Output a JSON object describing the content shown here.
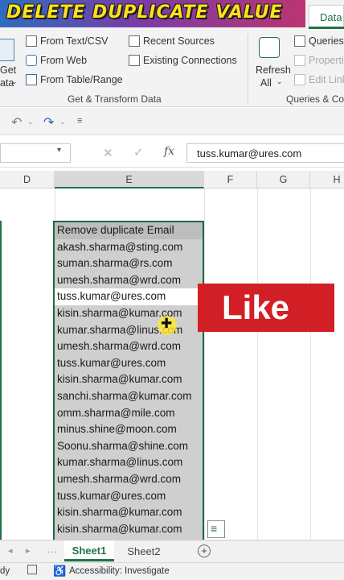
{
  "banner": {
    "title": "DELETE DUPLICATE VALUE"
  },
  "ribbon": {
    "active_tab": "Data",
    "get_data_label_1": "Get",
    "get_data_label_2": "ata",
    "get_transform": {
      "from_text": "From Text/CSV",
      "from_web": "From Web",
      "from_table": "From Table/Range",
      "recent_sources": "Recent Sources",
      "existing_connections": "Existing Connections",
      "group_label": "Get & Transform Data"
    },
    "queries": {
      "refresh_1": "Refresh",
      "refresh_2": "All",
      "queries_label": "Queries",
      "properties_label": "Properti",
      "edit_links_label": "Edit Link",
      "group_label": "Queries & Co"
    }
  },
  "formula_bar": {
    "value": "tuss.kumar@ures.com",
    "fx": "fx"
  },
  "columns": [
    "D",
    "E",
    "F",
    "G",
    "H"
  ],
  "table": {
    "header": "Remove duplicate Email",
    "rows": [
      "akash.sharma@sting.com",
      "suman.sharma@rs.com",
      "umesh.sharma@wrd.com",
      "tuss.kumar@ures.com",
      "kisin.sharma@kumar.com",
      "kumar.sharma@linus.com",
      "umesh.sharma@wrd.com",
      "tuss.kumar@ures.com",
      "kisin.sharma@kumar.com",
      "sanchi.sharma@kumar.com",
      "omm.sharma@mile.com",
      "minus.shine@moon.com",
      "Soonu.sharma@shine.com",
      "kumar.sharma@linus.com",
      "umesh.sharma@wrd.com",
      "tuss.kumar@ures.com",
      "kisin.sharma@kumar.com",
      "kisin.sharma@kumar.com"
    ]
  },
  "overlay": {
    "like": "Like"
  },
  "sheets": {
    "sheet1": "Sheet1",
    "sheet2": "Sheet2",
    "add": "+"
  },
  "status": {
    "ready": "dy",
    "accessibility": "Accessibility: Investigate"
  }
}
